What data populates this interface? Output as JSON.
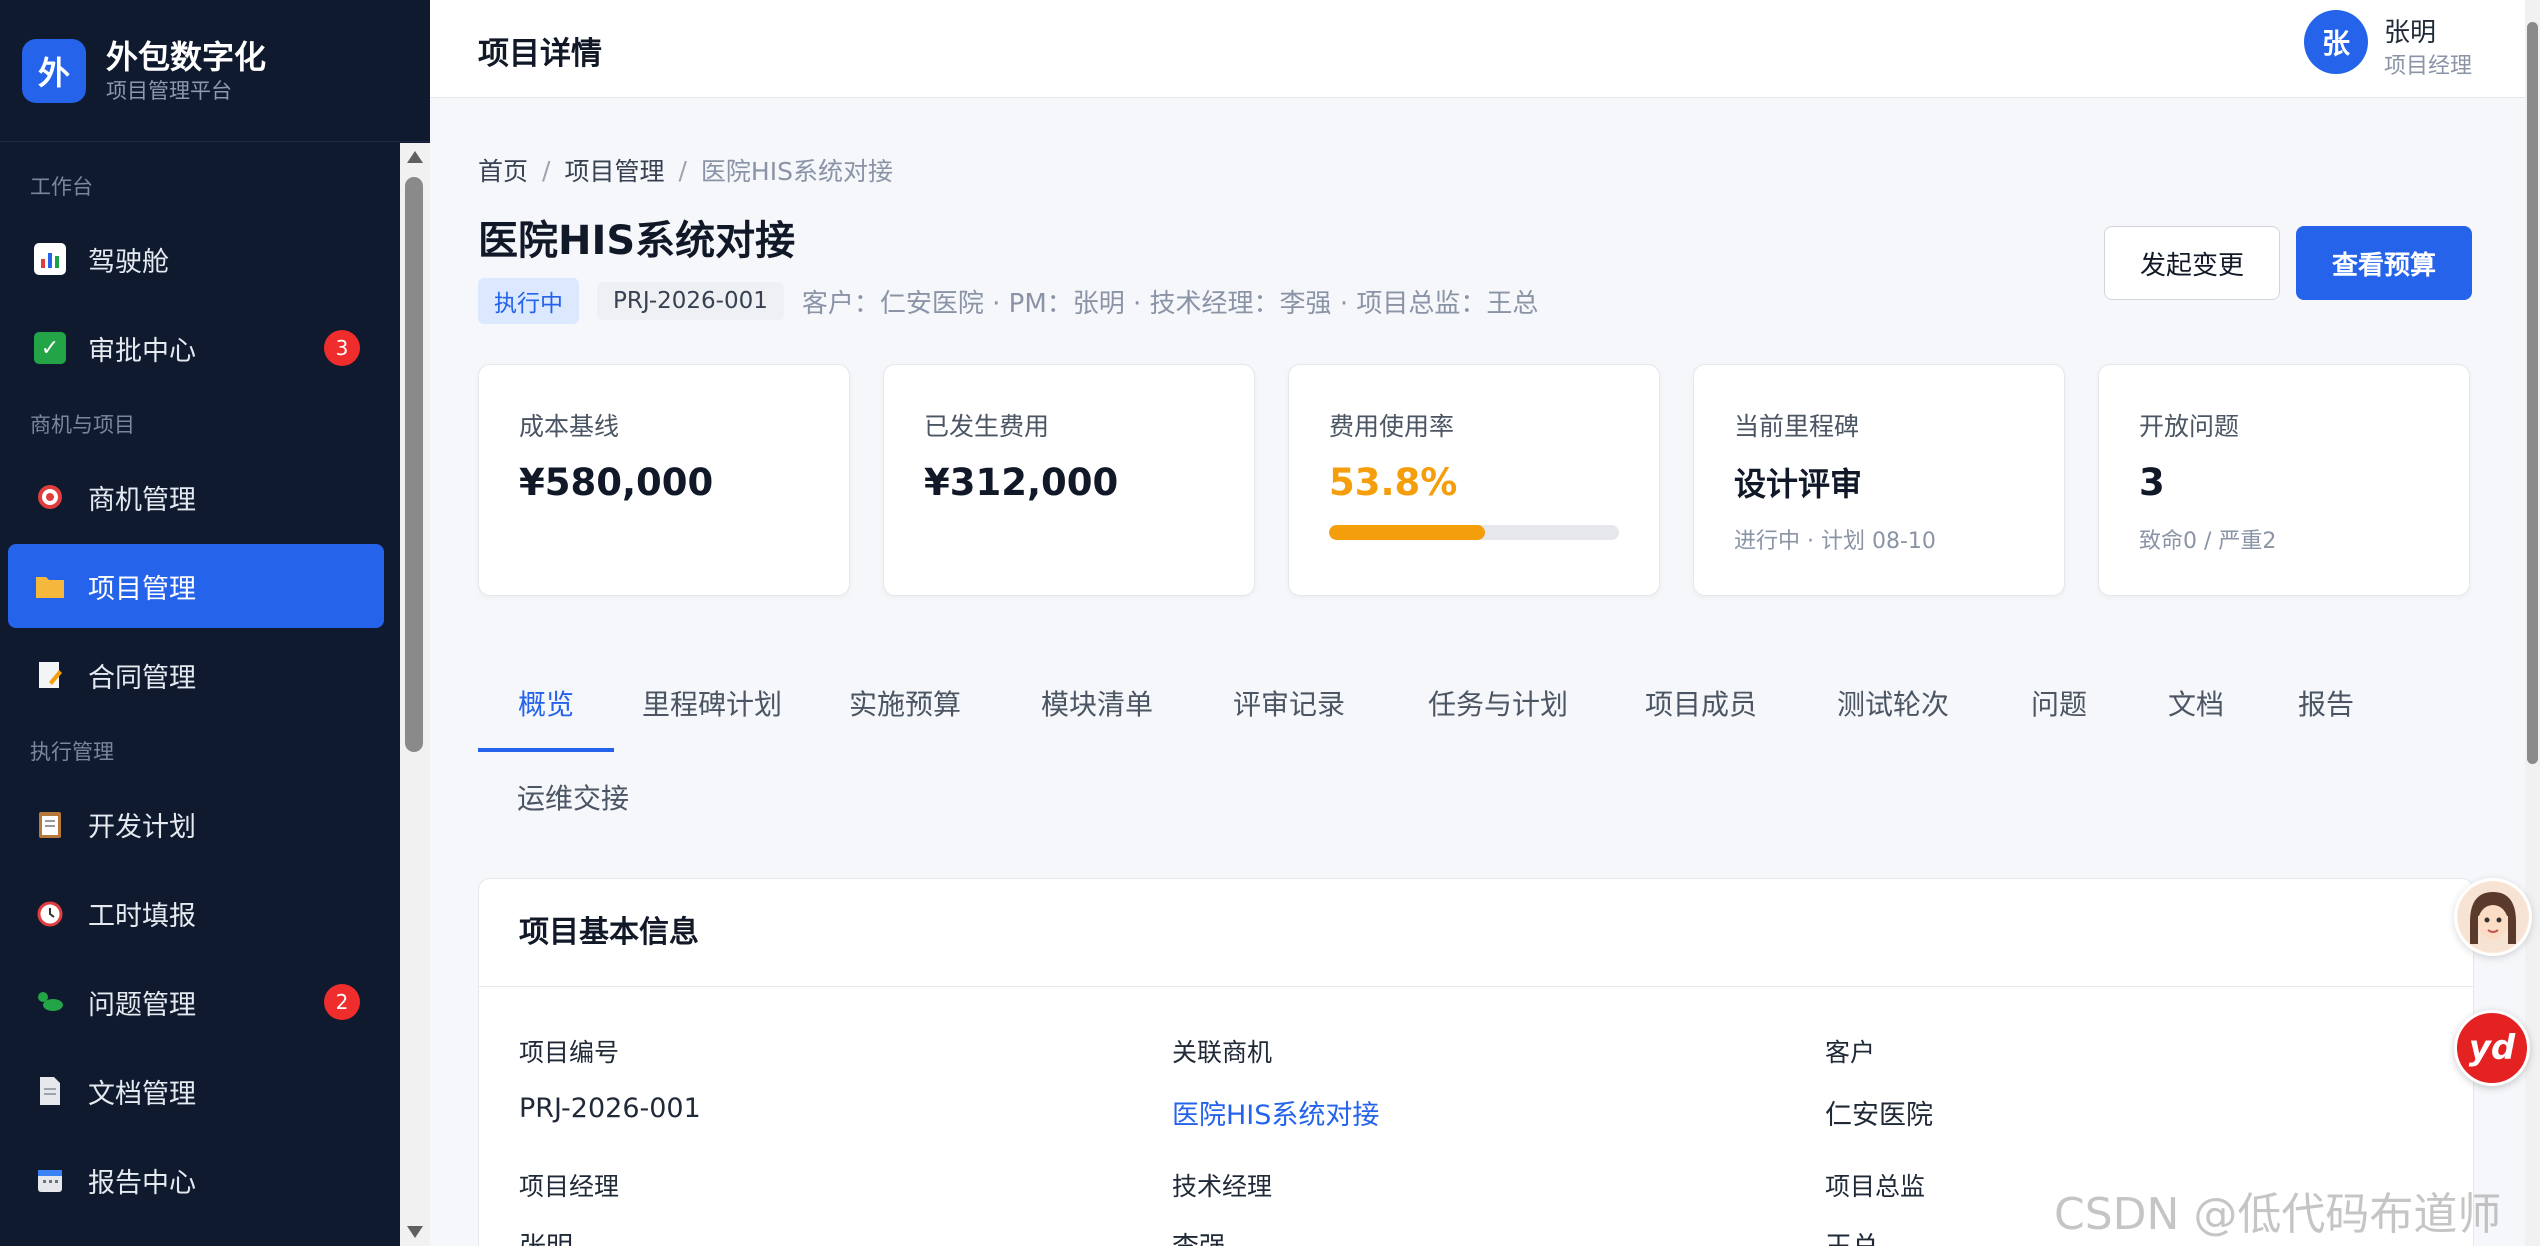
{
  "brand": {
    "logo_char": "外",
    "title": "外包数字化",
    "subtitle": "项目管理平台"
  },
  "sidebar": {
    "sections": [
      {
        "label": "工作台"
      },
      {
        "label": "商机与项目"
      },
      {
        "label": "执行管理"
      }
    ],
    "items": [
      {
        "label": "驾驶舱",
        "icon": "chart-icon"
      },
      {
        "label": "审批中心",
        "icon": "check-icon",
        "badge": "3"
      },
      {
        "label": "商机管理",
        "icon": "target-icon"
      },
      {
        "label": "项目管理",
        "icon": "folder-icon",
        "active": true
      },
      {
        "label": "合同管理",
        "icon": "contract-icon"
      },
      {
        "label": "开发计划",
        "icon": "clipboard-icon"
      },
      {
        "label": "工时填报",
        "icon": "clock-icon"
      },
      {
        "label": "问题管理",
        "icon": "bug-icon",
        "badge": "2"
      },
      {
        "label": "文档管理",
        "icon": "document-icon"
      },
      {
        "label": "报告中心",
        "icon": "calendar-icon"
      }
    ]
  },
  "header": {
    "title": "项目详情"
  },
  "user": {
    "avatar_char": "张",
    "name": "张明",
    "role": "项目经理"
  },
  "breadcrumb": [
    "首页",
    "项目管理",
    "医院HIS系统对接"
  ],
  "breadcrumb_separator": "/",
  "project": {
    "title": "医院HIS系统对接",
    "status": "执行中",
    "code": "PRJ-2026-001",
    "meta": "客户：仁安医院 · PM：张明 · 技术经理：李强 · 项目总监：王总"
  },
  "actions": {
    "change": "发起变更",
    "budget": "查看预算"
  },
  "stats": [
    {
      "label": "成本基线",
      "value": "¥580,000"
    },
    {
      "label": "已发生费用",
      "value": "¥312,000"
    },
    {
      "label": "费用使用率",
      "value": "53.8%",
      "progress": 0.538
    },
    {
      "label": "当前里程碑",
      "value": "设计评审",
      "sub": "进行中 · 计划 08-10"
    },
    {
      "label": "开放问题",
      "value": "3",
      "sub": "致命0 / 严重2"
    }
  ],
  "tabs": [
    "概览",
    "里程碑计划",
    "实施预算",
    "模块清单",
    "评审记录",
    "任务与计划",
    "项目成员",
    "测试轮次",
    "问题",
    "文档",
    "报告",
    "运维交接"
  ],
  "active_tab": "概览",
  "info": {
    "title": "项目基本信息",
    "fields": [
      {
        "label": "项目编号",
        "value": "PRJ-2026-001"
      },
      {
        "label": "关联商机",
        "value": "医院HIS系统对接",
        "link": true
      },
      {
        "label": "客户",
        "value": "仁安医院"
      },
      {
        "label": "项目经理",
        "value": "张明"
      },
      {
        "label": "技术经理",
        "value": "李强"
      },
      {
        "label": "项目总监",
        "value": "王总"
      }
    ]
  },
  "floating": {
    "yd_label": "yd"
  },
  "watermark": "CSDN @低代码布道师",
  "colors": {
    "primary": "#2563eb",
    "sidebar_bg": "#0f1a2e",
    "warning": "#f59e0b",
    "badge": "#ef2d2d"
  }
}
